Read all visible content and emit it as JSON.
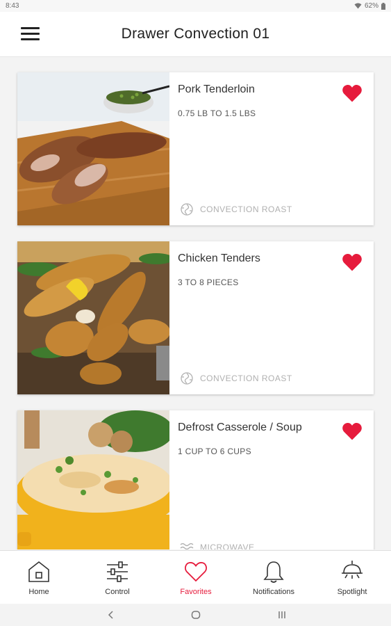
{
  "status_bar": {
    "time": "8:43",
    "battery": "62%"
  },
  "app_bar": {
    "title": "Drawer Convection 01"
  },
  "recipes": [
    {
      "name": "Pork Tenderloin",
      "range": "0.75 LB TO 1.5 LBS",
      "mode": "CONVECTION ROAST",
      "mode_icon": "convection-roast-icon",
      "favorite": true
    },
    {
      "name": "Chicken Tenders",
      "range": "3 TO 8 PIECES",
      "mode": "CONVECTION ROAST",
      "mode_icon": "convection-roast-icon",
      "favorite": true
    },
    {
      "name": "Defrost Casserole / Soup",
      "range": "1 CUP TO 6 CUPS",
      "mode": "MICROWAVE",
      "mode_icon": "microwave-icon",
      "favorite": true
    }
  ],
  "tabs": [
    {
      "label": "Home",
      "icon": "home-icon"
    },
    {
      "label": "Control",
      "icon": "sliders-icon"
    },
    {
      "label": "Favorites",
      "icon": "heart-icon",
      "active": true
    },
    {
      "label": "Notifications",
      "icon": "bell-icon"
    },
    {
      "label": "Spotlight",
      "icon": "spotlight-icon"
    }
  ],
  "colors": {
    "accent": "#e61b3c",
    "text": "#333333",
    "muted": "#b0b0b0"
  }
}
